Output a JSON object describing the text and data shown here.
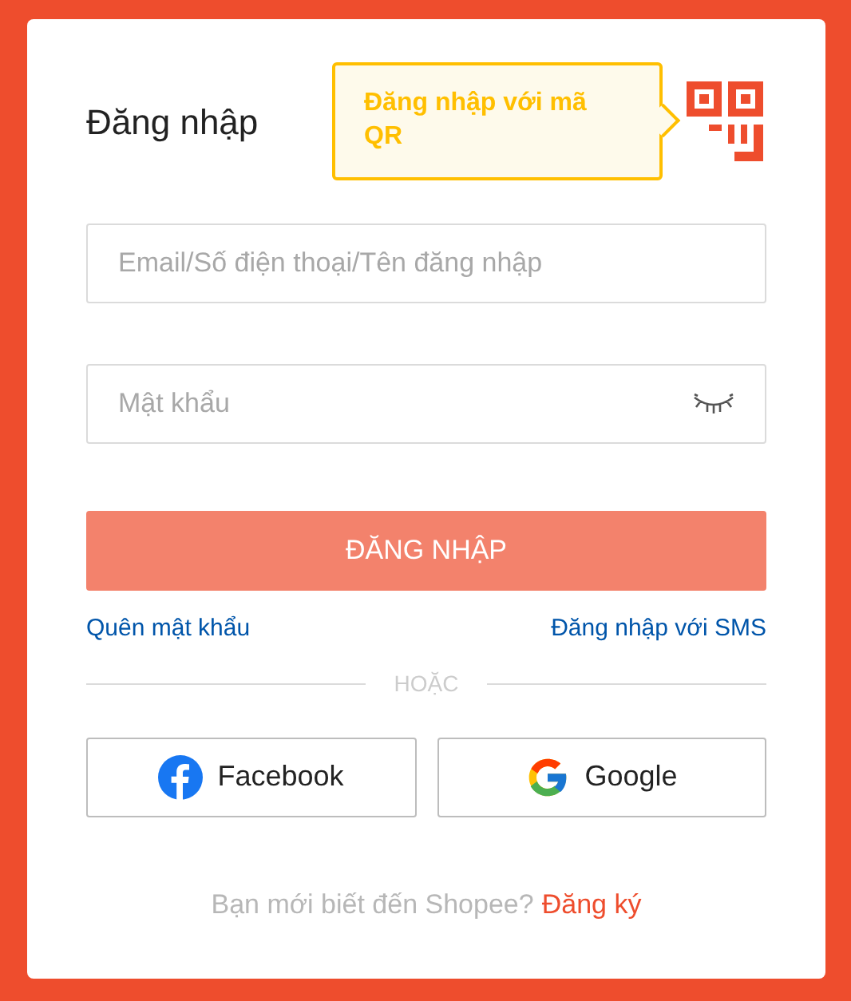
{
  "title": "Đăng nhập",
  "qr_tooltip": "Đăng nhập với mã QR",
  "fields": [
    {
      "kind": "text",
      "placeholder": "Email/Số điện thoại/Tên đăng nhập"
    },
    {
      "kind": "password",
      "placeholder": "Mật khẩu",
      "visible": false
    }
  ],
  "submit": {
    "label": "ĐĂNG NHẬP",
    "disabled": true
  },
  "links": [
    "Quên mật khẩu",
    "Đăng nhập với SMS"
  ],
  "divider": "HOẶC",
  "social": [
    {
      "kind": "facebook",
      "label": "Facebook"
    },
    {
      "kind": "google",
      "label": "Google"
    }
  ],
  "signup": {
    "text": "Bạn mới biết đến Shopee?",
    "link": "Đăng ký"
  }
}
